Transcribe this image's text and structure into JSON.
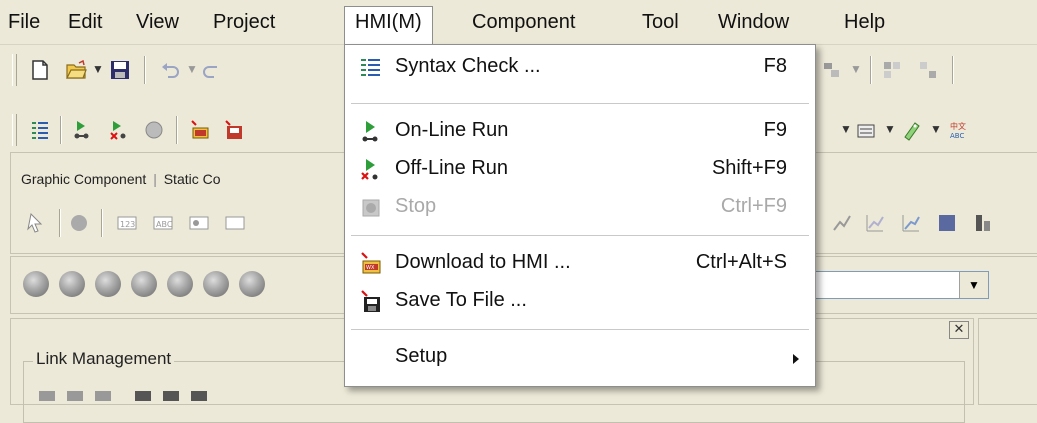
{
  "menubar": {
    "items": [
      "File",
      "Edit",
      "View",
      "Project",
      "HMI(M)",
      "Component",
      "Tool",
      "Window",
      "Help"
    ]
  },
  "left_panel": {
    "tabs": [
      "Graphic Component",
      "Static Co"
    ]
  },
  "link_management": {
    "title": "Link Management"
  },
  "hmi_menu": {
    "items": [
      {
        "label": "Syntax Check ...",
        "shortcut": "F8",
        "icon": "syntax-check-icon",
        "enabled": true
      },
      {
        "label": "On-Line Run",
        "shortcut": "F9",
        "icon": "online-run-icon",
        "enabled": true
      },
      {
        "label": "Off-Line Run",
        "shortcut": "Shift+F9",
        "icon": "offline-run-icon",
        "enabled": true
      },
      {
        "label": "Stop",
        "shortcut": "Ctrl+F9",
        "icon": "stop-icon",
        "enabled": false
      },
      {
        "label": "Download to HMI ...",
        "shortcut": "Ctrl+Alt+S",
        "icon": "download-icon",
        "enabled": true
      },
      {
        "label": "Save To File ...",
        "shortcut": "",
        "icon": "save-to-file-icon",
        "enabled": true
      },
      {
        "label": "Setup",
        "shortcut": "",
        "icon": "",
        "enabled": true,
        "submenu": true
      }
    ]
  },
  "colors": {
    "background": "#ece9d8",
    "menu_bg": "#ffffff",
    "disabled_text": "#a9a9a9"
  }
}
